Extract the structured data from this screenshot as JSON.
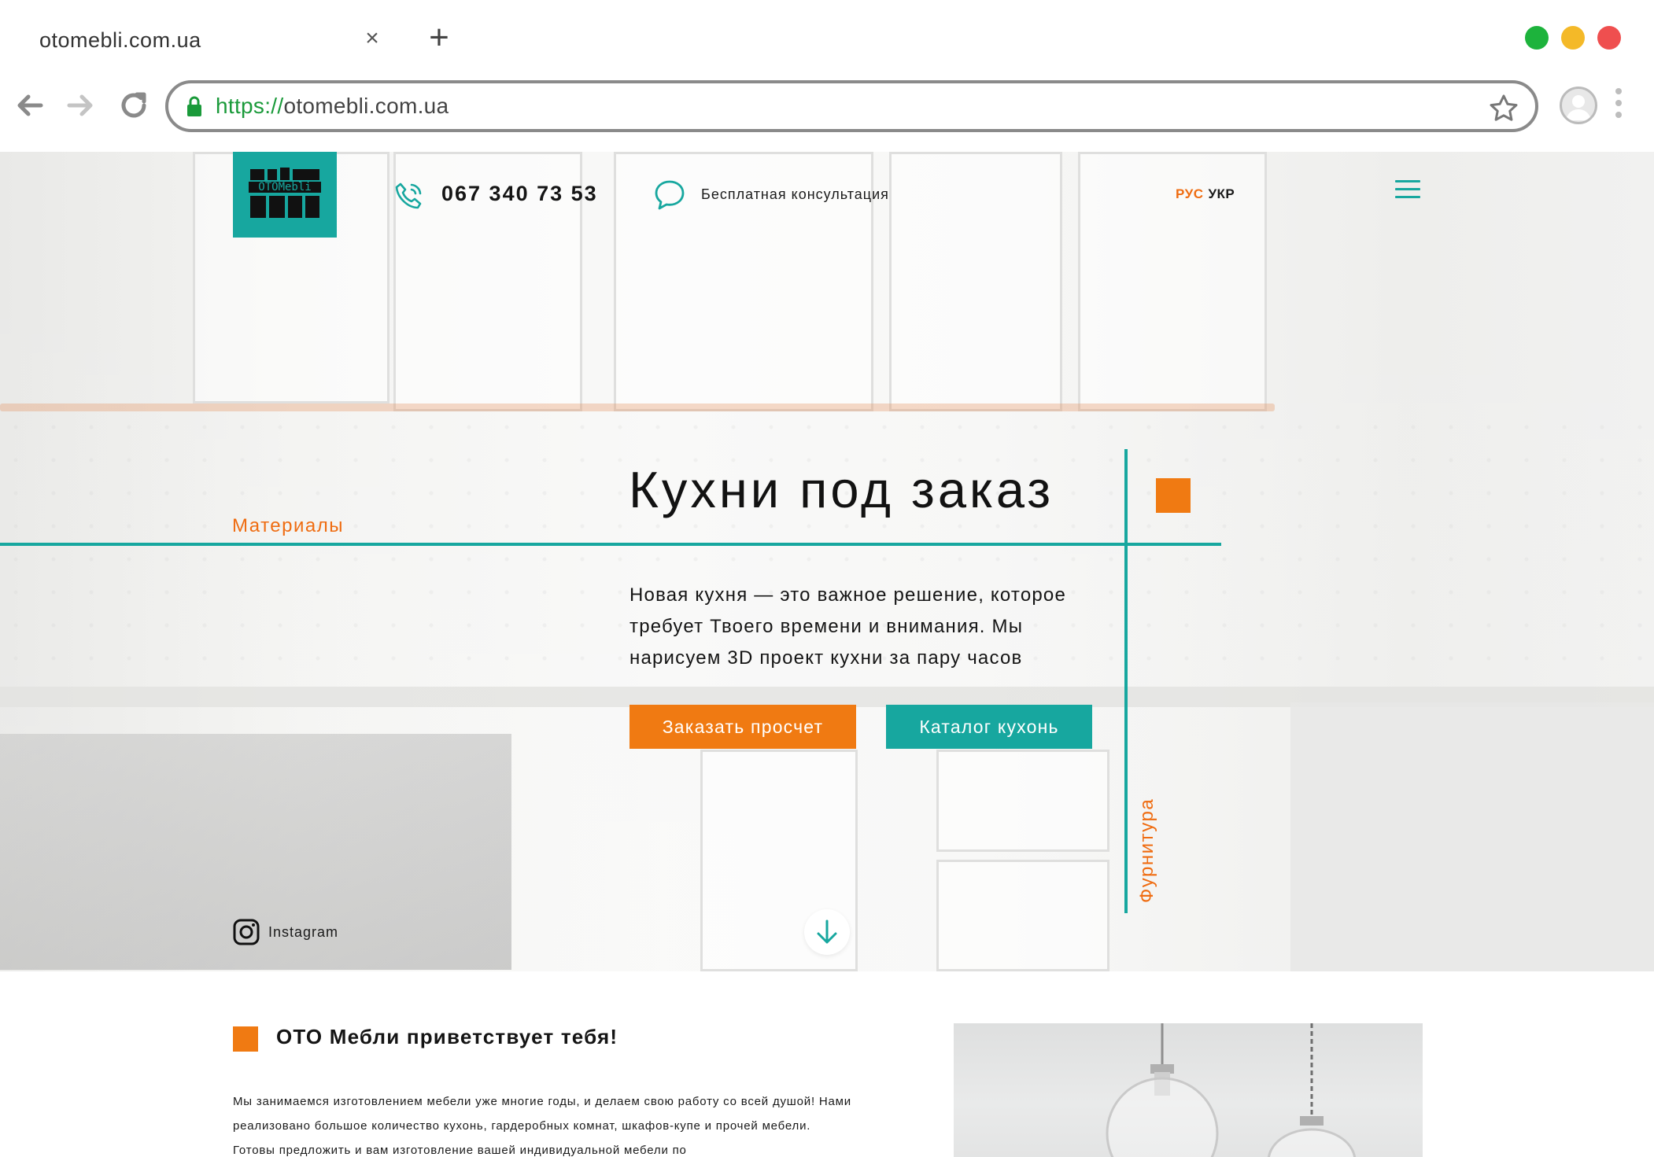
{
  "browser": {
    "tab_title": "otomebli.com.ua",
    "tab_close": "×",
    "new_tab": "+",
    "url_scheme": "https://",
    "url_host": "otomebli.com.ua",
    "window_controls": {
      "green": "#1db33c",
      "yellow": "#f4b928",
      "red": "#ef4f4f"
    }
  },
  "header": {
    "logo_text": "OTOMebli",
    "phone": "067 340 73 53",
    "consultation": "Бесплатная консультация",
    "lang_ru": "РУС",
    "lang_uk": "УКР"
  },
  "hero": {
    "title": "Кухни под заказ",
    "text": "Новая кухня — это важное решение, которое требует Твоего времени и внимания. Мы нарисуем 3D проект кухни за пару часов",
    "label_left": "Материалы",
    "label_right": "Фурнитура",
    "btn_order": "Заказать просчет",
    "btn_catalog": "Каталог кухонь",
    "instagram": "Instagram"
  },
  "welcome": {
    "title": "ОТО Мебли приветствует тебя!",
    "text": "Мы занимаемся изготовлением мебели уже многие годы, и делаем свою работу со всей душой! Нами реализовано большое количество кухонь, гардеробных комнат, шкафов-купе и прочей мебели. Готовы предложить и вам изготовление вашей индивидуальной мебели по"
  },
  "colors": {
    "accent_teal": "#17a79f",
    "accent_orange": "#f07a12"
  },
  "icons": [
    "back-arrow-icon",
    "forward-arrow-icon",
    "reload-icon",
    "lock-icon",
    "star-icon",
    "profile-icon",
    "kebab-menu-icon",
    "phone-icon",
    "chat-icon",
    "burger-menu-icon",
    "instagram-icon",
    "arrow-down-icon"
  ]
}
